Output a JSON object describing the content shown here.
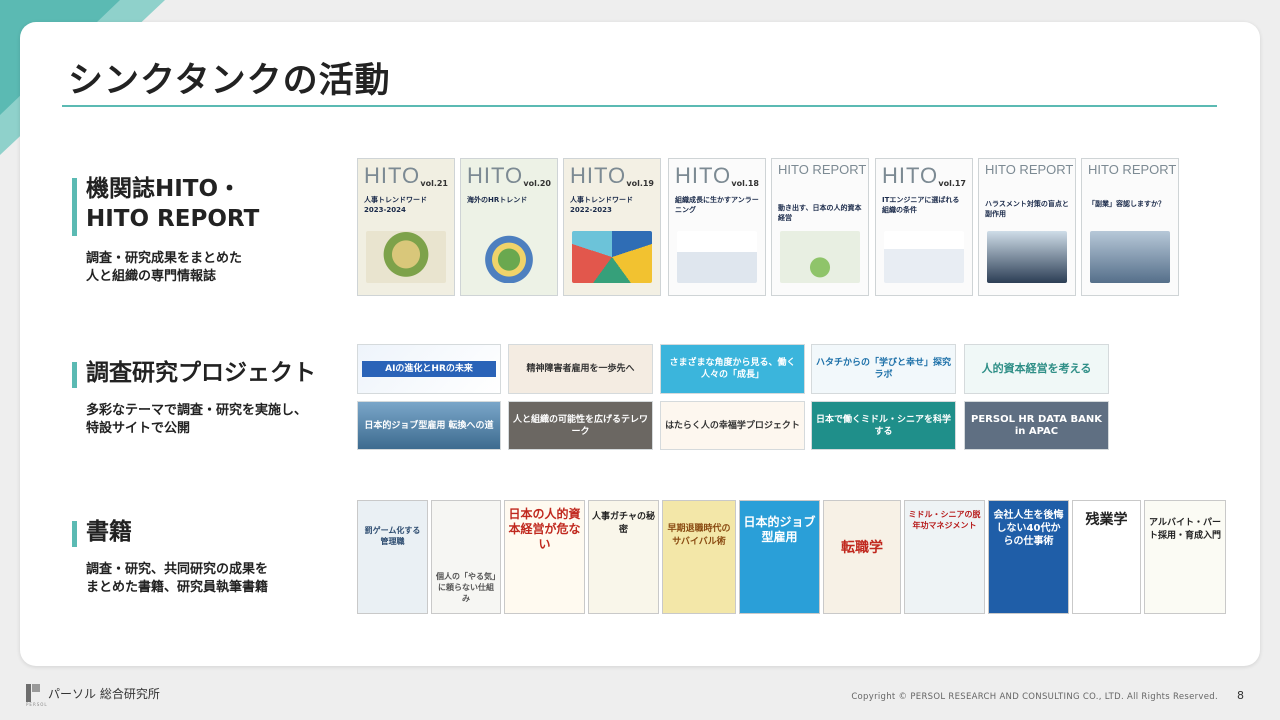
{
  "title": "シンクタンクの活動",
  "accent_color": "#5bbab3",
  "sections": [
    {
      "heading_line1": "機関誌HITO・",
      "heading_line2": "HITO REPORT",
      "desc_line1": "調査・研究成果をまとめた",
      "desc_line2": "人と組織の専門情報誌"
    },
    {
      "heading_line1": "調査研究プロジェクト",
      "desc_line1": "多彩なテーマで調査・研究を実施し、",
      "desc_line2": "特設サイトで公開"
    },
    {
      "heading_line1": "書籍",
      "desc_line1": "調査・研究、共同研究の成果を",
      "desc_line2": "まとめた書籍、研究員執筆書籍"
    }
  ],
  "magazines": [
    {
      "mast": "HITO",
      "vol": "vol.21",
      "caption": "人事トレンドワード 2023-2024"
    },
    {
      "mast": "HITO",
      "vol": "vol.20",
      "caption": "海外のHRトレンド"
    },
    {
      "mast": "HITO",
      "vol": "vol.19",
      "caption": "人事トレンドワード 2022-2023"
    },
    {
      "mast": "HITO",
      "vol": "vol.18",
      "caption": "組織成長に生かすアンラーニング"
    },
    {
      "mast": "HITO REPORT",
      "vol": "",
      "caption": "動き出す、日本の人的資本経営"
    },
    {
      "mast": "HITO",
      "vol": "vol.17",
      "caption": "ITエンジニアに選ばれる組織の条件"
    },
    {
      "mast": "HITO REPORT",
      "vol": "",
      "caption": "ハラスメント対策の盲点と副作用"
    },
    {
      "mast": "HITO REPORT",
      "vol": "",
      "caption": "「副業」容認しますか？"
    }
  ],
  "projects": [
    {
      "label": "AIの進化とHRの未来"
    },
    {
      "label": "精神障害者雇用を一歩先へ"
    },
    {
      "label": "さまざまな角度から見る、働く人々の「成長」"
    },
    {
      "label": "ハタチからの「学びと幸せ」探究ラボ"
    },
    {
      "label": "人的資本経営を考える"
    },
    {
      "label": "日本的ジョブ型雇用 転換への道"
    },
    {
      "label": "人と組織の可能性を広げるテレワーク"
    },
    {
      "label": "はたらく人の幸福学プロジェクト"
    },
    {
      "label": "日本で働くミドル・シニアを科学する"
    },
    {
      "label": "PERSOL HR DATA BANK in APAC"
    }
  ],
  "books": [
    {
      "label": "罰ゲーム化する管理職"
    },
    {
      "label": "個人の「やる気」に頼らない仕組み"
    },
    {
      "label": "日本の人的資本経営が危ない"
    },
    {
      "label": "人事ガチャの秘密"
    },
    {
      "label": "早期退職時代のサバイバル術"
    },
    {
      "label": "日本的ジョブ型雇用"
    },
    {
      "label": "転職学"
    },
    {
      "label": "ミドル・シニアの脱年功マネジメント"
    },
    {
      "label": "会社人生を後悔しない40代からの仕事術"
    },
    {
      "label": "残業学"
    },
    {
      "label": "アルバイト・パート採用・育成入門"
    }
  ],
  "footer": {
    "logo_text": "パーソル 総合研究所",
    "logo_sub": "PERSOL",
    "copyright": "Copyright © PERSOL RESEARCH AND CONSULTING CO., LTD. All Rights Reserved.",
    "page_number": "8"
  }
}
